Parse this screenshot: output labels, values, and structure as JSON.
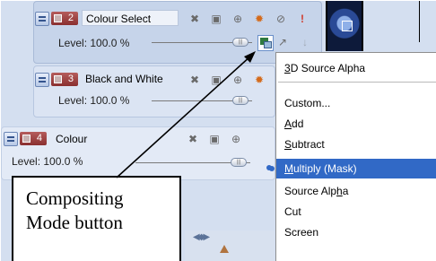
{
  "tracks": [
    {
      "number": "2",
      "name": "Colour Select",
      "level": "Level: 100.0 %"
    },
    {
      "number": "3",
      "name": "Black and White",
      "level": "Level: 100.0 %"
    },
    {
      "number": "4",
      "name": "Colour",
      "level": "Level: 100.0 %"
    }
  ],
  "toolbar_icons": [
    "bypass-fx-icon",
    "generate-media-icon",
    "track-motion-icon",
    "track-fx-icon",
    "mute-icon",
    "solo-icon",
    "compositing-mode-icon",
    "parent-up-icon",
    "child-down-icon"
  ],
  "menu": {
    "items": [
      {
        "label": "3D Source Alpha",
        "key_letter": "3"
      },
      {
        "label": "Custom...",
        "key_letter": ""
      },
      {
        "label": "Add",
        "key_letter": "A"
      },
      {
        "label": "Subtract",
        "key_letter": "S"
      },
      {
        "label": "Multiply (Mask)",
        "key_letter": "M",
        "selected": true
      },
      {
        "label": "Source Alpha",
        "key_letter": "h"
      },
      {
        "label": "Cut",
        "key_letter": ""
      },
      {
        "label": "Screen",
        "key_letter": ""
      }
    ]
  },
  "callout": {
    "line1": "Compositing",
    "line2": "Mode button"
  },
  "colors": {
    "selection": "#3169c6",
    "track_number": "#8a2f2f",
    "panel": "#d4dff0"
  }
}
